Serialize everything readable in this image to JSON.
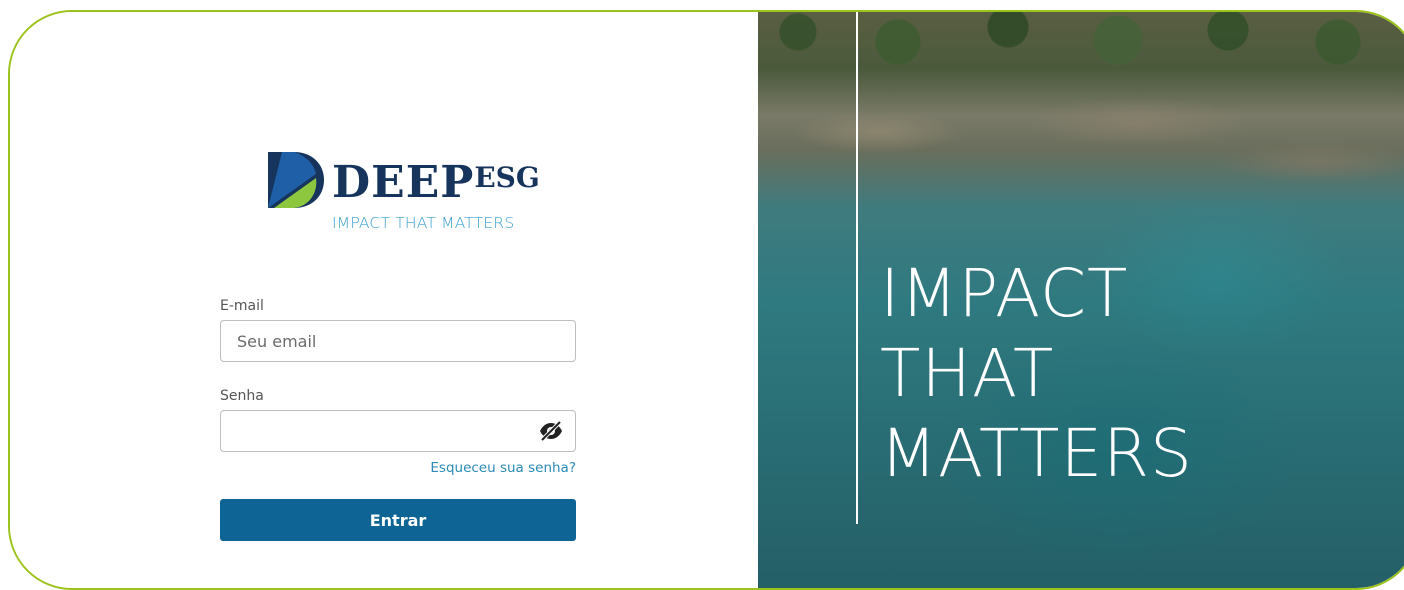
{
  "brand": {
    "name_main": "DEEP",
    "name_suffix": "ESG",
    "tagline": "IMPACT THAT MATTERS",
    "colors": {
      "navy": "#16345c",
      "green": "#8dc63f",
      "blue": "#3a9fd0",
      "border": "#9cc31c"
    }
  },
  "form": {
    "email_label": "E-mail",
    "email_placeholder": "Seu email",
    "password_label": "Senha",
    "password_value": "",
    "toggle_icon": "eye-slash-icon",
    "forgot_label": "Esqueceu sua senha?",
    "submit_label": "Entrar",
    "submit_color": "#0f6496"
  },
  "hero": {
    "lines": [
      "IMPACT",
      "THAT",
      "MATTERS"
    ]
  }
}
